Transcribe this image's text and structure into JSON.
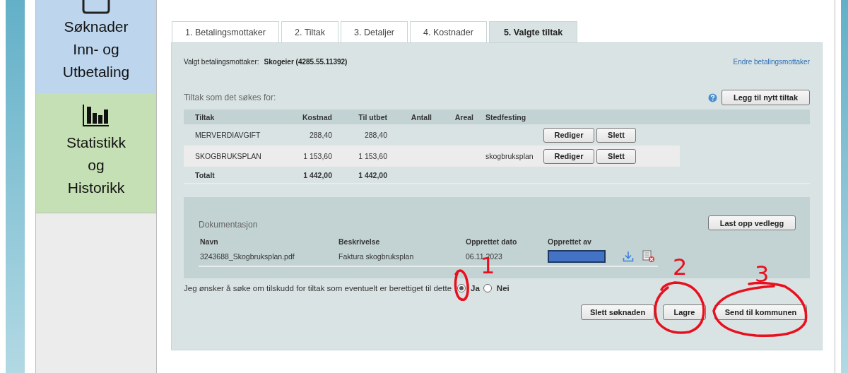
{
  "sidebar": {
    "items": [
      {
        "kind": "apply",
        "label": "Søknader Inn- og Utbetaling"
      },
      {
        "kind": "stats",
        "label": "Statistikk og Historikk"
      }
    ]
  },
  "tabs": [
    {
      "label": "1. Betalingsmottaker",
      "selected": false
    },
    {
      "label": "2. Tiltak",
      "selected": false
    },
    {
      "label": "3. Detaljer",
      "selected": false
    },
    {
      "label": "4. Kostnader",
      "selected": false
    },
    {
      "label": "5. Valgte tiltak",
      "selected": true
    }
  ],
  "recipient": {
    "label": "Valgt betalingsmottaker:",
    "value": "Skogeier (4285.55.11392)",
    "change_link": "Endre betalingsmottaker"
  },
  "measures": {
    "title": "Tiltak som det søkes for:",
    "add_button": "Legg til nytt tiltak",
    "columns": [
      "Tiltak",
      "Kostnad",
      "Til utbet",
      "Antall",
      "Areal",
      "Stedfesting"
    ],
    "rows": [
      {
        "cells": [
          "MERVERDIAVGIFT",
          "288,40",
          "288,40",
          "",
          "",
          ""
        ],
        "buttons": [
          "Rediger",
          "Slett"
        ]
      },
      {
        "cells": [
          "SKOGBRUKSPLAN",
          "1 153,60",
          "1 153,60",
          "",
          "",
          "skogbruksplan"
        ],
        "buttons": [
          "Rediger",
          "Slett"
        ]
      }
    ],
    "total": [
      "Totalt",
      "1 442,00",
      "1 442,00"
    ]
  },
  "documentation": {
    "title": "Dokumentasjon",
    "upload_button": "Last opp vedlegg",
    "columns": [
      "Navn",
      "Beskrivelse",
      "Opprettet dato",
      "Opprettet av"
    ],
    "rows": [
      {
        "name": "3243688_Skogbruksplan.pdf",
        "description": "Faktura skogbruksplan",
        "date": "06.11.2023"
      }
    ]
  },
  "question": {
    "text": "Jeg ønsker å søke om tilskudd for tiltak som eventuelt er berettiget til dette",
    "options": [
      {
        "label": "Ja",
        "selected": true
      },
      {
        "label": "Nei",
        "selected": false
      }
    ]
  },
  "actions": [
    "Slett søknaden",
    "Lagre",
    "Send til kommunen"
  ],
  "annotations": [
    {
      "label": "1"
    },
    {
      "label": "2"
    },
    {
      "label": "3"
    }
  ]
}
